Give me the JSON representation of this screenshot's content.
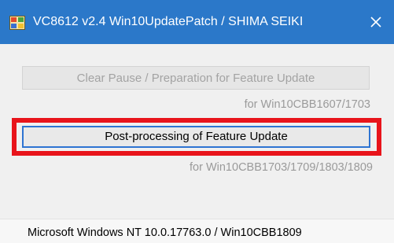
{
  "window": {
    "title": "VC8612 v2.4  Win10UpdatePatch / SHIMA SEIKI",
    "app_icon": "app-window-icon",
    "close_icon": "close-icon"
  },
  "main": {
    "clear_pause_button": "Clear Pause / Preparation for Feature Update",
    "clear_pause_note": "for Win10CBB1607/1703",
    "post_processing_button": "Post-processing of Feature Update",
    "post_processing_note": "for Win10CBB1703/1709/1803/1809"
  },
  "status": {
    "os_version": "Microsoft Windows NT 10.0.17763.0 / Win10CBB1809"
  },
  "colors": {
    "titlebar": "#2b78c9",
    "highlight_border": "#e8141b",
    "button_focus_border": "#2e74d2"
  }
}
